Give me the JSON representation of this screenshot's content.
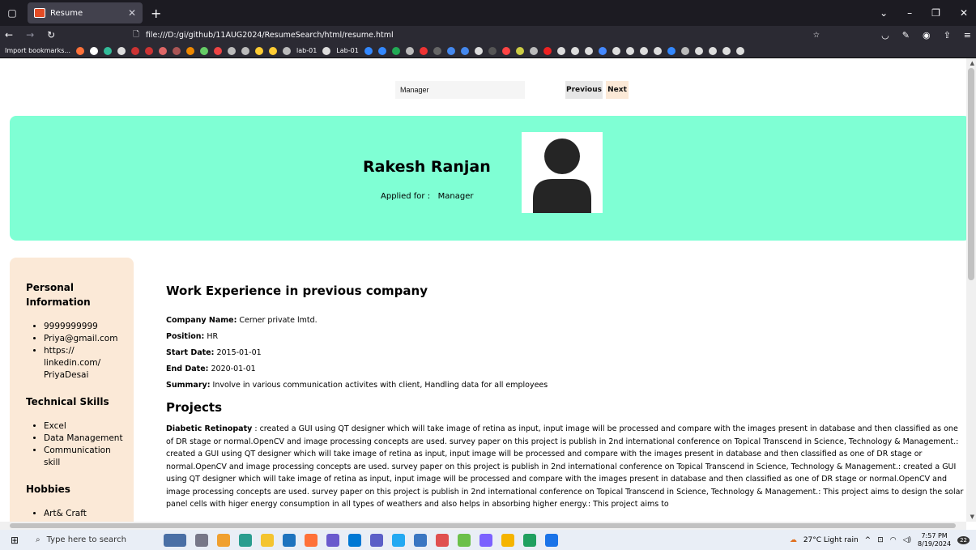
{
  "browser": {
    "tab_title": "Resume",
    "url": "file:///D:/gi/github/11AUG2024/ResumeSearch/html/resume.html",
    "import_bookmarks": "Import bookmarks...",
    "bookmarks": [
      "lab-01",
      "Lab-01",
      "Lab-01"
    ]
  },
  "search": {
    "value": "Manager"
  },
  "buttons": {
    "previous": "Previous",
    "next": "Next"
  },
  "hero": {
    "name": "Rakesh Ranjan",
    "applied_label": "Applied for :",
    "applied_value": "Manager"
  },
  "sidebar": {
    "personal_heading": "Personal Information",
    "personal": [
      "9999999999",
      "Priya@gmail.com",
      "https:// linkedin.com/ PriyaDesai"
    ],
    "skills_heading": "Technical Skills",
    "skills": [
      "Excel",
      "Data Management",
      "Communication skill"
    ],
    "hobbies_heading": "Hobbies",
    "hobbies": [
      "Art& Craft"
    ]
  },
  "work": {
    "heading": "Work Experience in previous company",
    "company_label": "Company Name:",
    "company": "Cerner private lmtd.",
    "position_label": "Position:",
    "position": "HR",
    "start_label": "Start Date:",
    "start": "2015-01-01",
    "end_label": "End Date:",
    "end": "2020-01-01",
    "summary_label": "Summary:",
    "summary": "Involve in various communication activites with client, Handling data for all employees"
  },
  "projects": {
    "heading": "Projects",
    "title": "Diabetic Retinopaty",
    "text": " : created a GUI using QT designer which will take image of retina as input, input image will be processed and compare with the images present in database and then classified as one of DR stage or normal.OpenCV and image processing concepts are used. survey paper on this project is publish in 2nd international conference on Topical Transcend in Science, Technology & Management.: created a GUI using QT designer which will take image of retina as input, input image will be processed and compare with the images present in database and then classified as one of DR stage or normal.OpenCV and image processing concepts are used. survey paper on this project is publish in 2nd international conference on Topical Transcend in Science, Technology & Management.: created a GUI using QT designer which will take image of retina as input, input image will be processed and compare with the images present in database and then classified as one of DR stage or normal.OpenCV and image processing concepts are used. survey paper on this project is publish in 2nd international conference on Topical Transcend in Science, Technology & Management.: This project aims to design the solar panel cells with higer energy consumption in all types of weathers and also helps in absorbing higher energy.: This project aims to"
  },
  "taskbar": {
    "search_placeholder": "Type here to search",
    "weather": "27°C  Light rain",
    "time": "7:57 PM",
    "date": "8/19/2024",
    "notifications": "22"
  }
}
